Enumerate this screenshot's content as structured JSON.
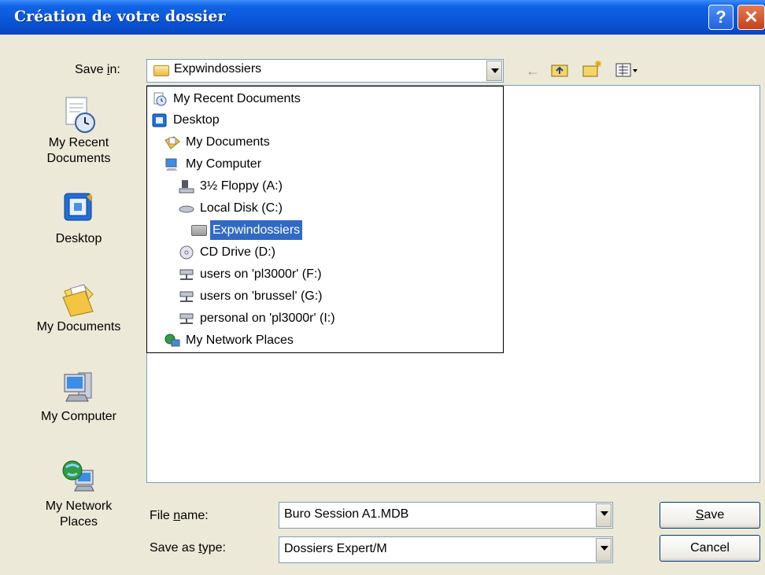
{
  "window": {
    "title": "Création de votre dossier",
    "help_glyph": "?",
    "close_glyph": "✕"
  },
  "save_in": {
    "label_pre": "Save ",
    "label_u": "i",
    "label_post": "n:",
    "value": "Expwindossiers"
  },
  "toolbar": {
    "icons": [
      "back-arrow-icon",
      "up-one-level-icon",
      "new-folder-icon",
      "views-menu-icon"
    ]
  },
  "places": [
    {
      "name": "recent",
      "label": "My Recent\nDocuments"
    },
    {
      "name": "desktop",
      "label": "Desktop"
    },
    {
      "name": "documents",
      "label": "My Documents"
    },
    {
      "name": "computer",
      "label": "My Computer"
    },
    {
      "name": "network",
      "label": "My Network\nPlaces"
    }
  ],
  "dropdown_items": [
    {
      "label": "My Recent Documents",
      "icon": "recent-documents-icon"
    },
    {
      "label": "Desktop",
      "icon": "desktop-icon"
    },
    {
      "label": "My Documents",
      "icon": "my-documents-icon"
    },
    {
      "label": "My Computer",
      "icon": "my-computer-icon"
    },
    {
      "label": "3½ Floppy (A:)",
      "icon": "floppy-drive-icon"
    },
    {
      "label": "Local Disk (C:)",
      "icon": "local-disk-icon"
    },
    {
      "label": "Expwindossiers",
      "icon": "folder-icon",
      "selected": true
    },
    {
      "label": "CD Drive (D:)",
      "icon": "cd-drive-icon"
    },
    {
      "label": "users on 'pl3000r' (F:)",
      "icon": "network-drive-icon"
    },
    {
      "label": "users on 'brussel' (G:)",
      "icon": "network-drive-icon"
    },
    {
      "label": "personal on 'pl3000r' (I:)",
      "icon": "network-drive-icon"
    },
    {
      "label": "My Network Places",
      "icon": "network-places-icon"
    }
  ],
  "file_name": {
    "label_pre": "File ",
    "label_u": "n",
    "label_post": "ame:",
    "value": "Buro Session A1.MDB"
  },
  "save_type": {
    "label_pre": "Save as ",
    "label_u": "t",
    "label_post": "ype:",
    "value": "Dossiers Expert/M"
  },
  "buttons": {
    "save_u": "S",
    "save_rest": "ave",
    "cancel": "Cancel"
  }
}
